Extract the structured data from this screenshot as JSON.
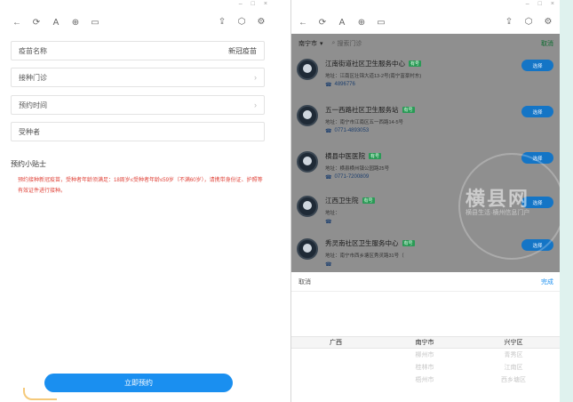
{
  "window": {
    "min": "–",
    "max": "□",
    "close": "×"
  },
  "toolbar": {
    "back": "←",
    "refresh": "⟳",
    "font": "A",
    "link": "⊕",
    "doc": "▭",
    "share": "⇪",
    "cube": "⬡",
    "gear": "⚙"
  },
  "form": {
    "vaccine_label": "疫苗名称",
    "vaccine_value": "新冠疫苗",
    "clinic_label": "接种门诊",
    "time_label": "预约时间",
    "recipient_label": "受种者",
    "chevron": "›"
  },
  "tips": {
    "title": "预约小贴士",
    "text": "预约接种新冠疫苗，受种者年龄须满足：18周岁≤受种者年龄≤59岁（不满60岁），请携带身份证、护照等有效证件进行接种。"
  },
  "submit_label": "立即预约",
  "search": {
    "city": "南宁市",
    "dropdown": "▾",
    "search_icon": "⌕",
    "placeholder": "搜索门诊",
    "cancel": "取消"
  },
  "clinics": [
    {
      "name": "江南街道社区卫生服务中心",
      "tag": "有号",
      "address": "地址：江南区壮锦大道13-2号(南宁富豪村东)",
      "phone": "4896776",
      "button": "选择"
    },
    {
      "name": "五一西路社区卫生服务站",
      "tag": "有号",
      "address": "地址：南宁市江南区五一西路14-5号",
      "phone": "0771-4893053",
      "button": "选择"
    },
    {
      "name": "横县中医医院",
      "tag": "有号",
      "address": "地址：横县横州镇公园路25号",
      "phone": "0771-7200809",
      "button": "选择"
    },
    {
      "name": "江西卫生院",
      "tag": "有号",
      "address": "地址：",
      "phone": "",
      "button": "选择"
    },
    {
      "name": "秀灵南社区卫生服务中心",
      "tag": "有号",
      "address": "地址：南宁市西乡塘区秀灵路31号（",
      "phone": "",
      "button": "选择"
    }
  ],
  "phone_icon": "☎",
  "watermark": {
    "title": "横县网",
    "subtitle": "横县生活·横州信息门户"
  },
  "picker": {
    "cancel": "取消",
    "done": "完成",
    "col1": [
      "广西"
    ],
    "col2": [
      "南宁市",
      "柳州市",
      "桂林市",
      "梧州市"
    ],
    "col3": [
      "兴宁区",
      "青秀区",
      "江南区",
      "西乡塘区"
    ]
  }
}
